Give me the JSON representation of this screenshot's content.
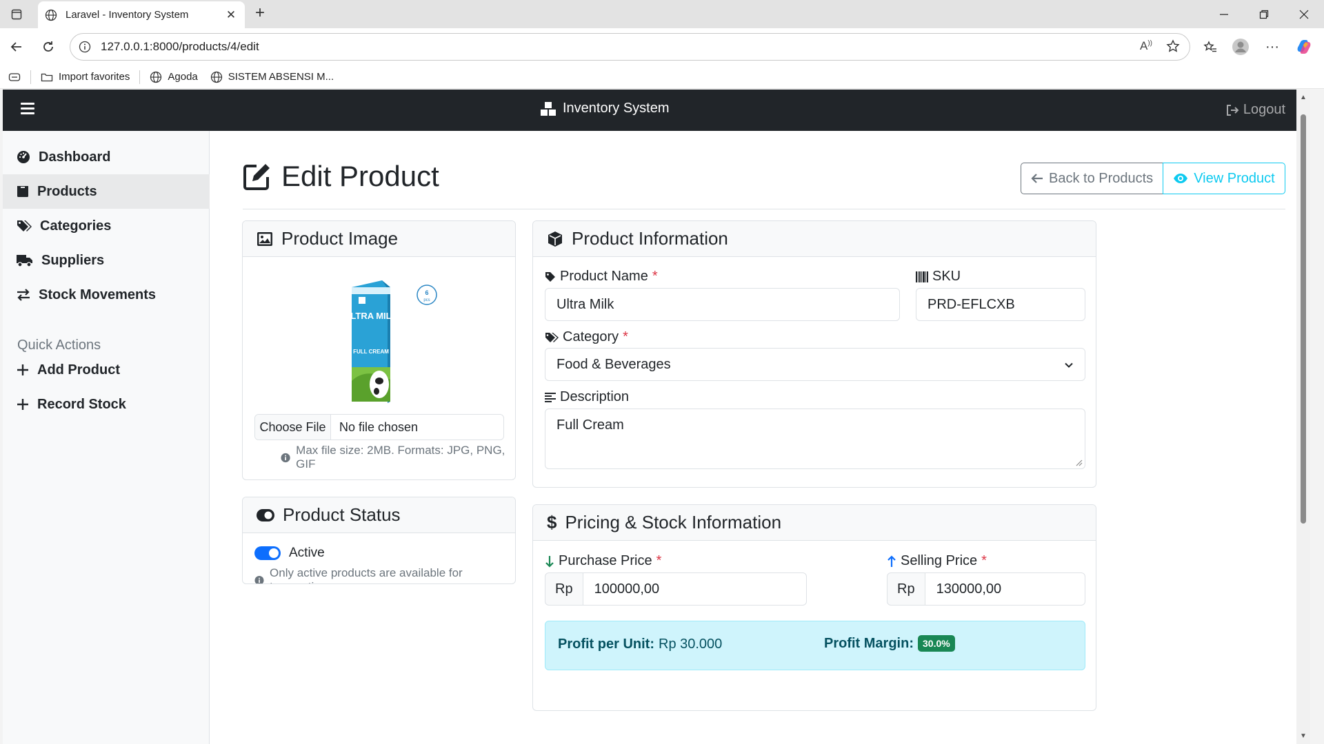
{
  "browser": {
    "tab_title": "Laravel - Inventory System",
    "url": "127.0.0.1:8000/products/4/edit",
    "bookmarks": [
      "Import favorites",
      "Agoda",
      "SISTEM ABSENSI M..."
    ]
  },
  "navbar": {
    "brand": "Inventory System",
    "logout": "Logout"
  },
  "sidebar": {
    "items": [
      {
        "label": "Dashboard",
        "icon": "gauge-icon"
      },
      {
        "label": "Products",
        "icon": "box-icon",
        "active": true
      },
      {
        "label": "Categories",
        "icon": "tags-icon"
      },
      {
        "label": "Suppliers",
        "icon": "truck-icon"
      },
      {
        "label": "Stock Movements",
        "icon": "exchange-icon"
      }
    ],
    "quick_actions_heading": "Quick Actions",
    "quick_actions": [
      {
        "label": "Add Product",
        "icon": "plus-icon"
      },
      {
        "label": "Record Stock",
        "icon": "plus-icon"
      }
    ]
  },
  "page": {
    "title": "Edit Product",
    "back_button": "Back to Products",
    "view_button": "View Product"
  },
  "image_card": {
    "title": "Product Image",
    "choose_file": "Choose File",
    "no_file": "No file chosen",
    "hint": "Max file size: 2MB. Formats: JPG, PNG, GIF",
    "product_image_text": {
      "brand": "ULTRA MILK",
      "variant": "FULL CREAM",
      "badge_count": "6",
      "badge_unit": "pcs"
    }
  },
  "status_card": {
    "title": "Product Status",
    "toggle_label": "Active",
    "toggle_on": true,
    "hint": "Only active products are available for transactions."
  },
  "info_card": {
    "title": "Product Information",
    "name_label": "Product Name",
    "name_value": "Ultra Milk",
    "sku_label": "SKU",
    "sku_value": "PRD-EFLCXB",
    "category_label": "Category",
    "category_value": "Food & Beverages",
    "description_label": "Description",
    "description_value": "Full Cream",
    "required_mark": "*"
  },
  "pricing_card": {
    "title": "Pricing & Stock Information",
    "purchase_label": "Purchase Price",
    "purchase_prefix": "Rp",
    "purchase_value": "100000,00",
    "selling_label": "Selling Price",
    "selling_prefix": "Rp",
    "selling_value": "130000,00",
    "profit_label": "Profit per Unit:",
    "profit_value": "Rp 30.000",
    "margin_label": "Profit Margin:",
    "margin_value": "30.0%"
  },
  "colors": {
    "navbar_bg": "#212529",
    "info": "#0dcaf0",
    "success": "#198754",
    "primary": "#0d6efd",
    "danger": "#dc3545",
    "alert_info_bg": "#cff4fc"
  }
}
